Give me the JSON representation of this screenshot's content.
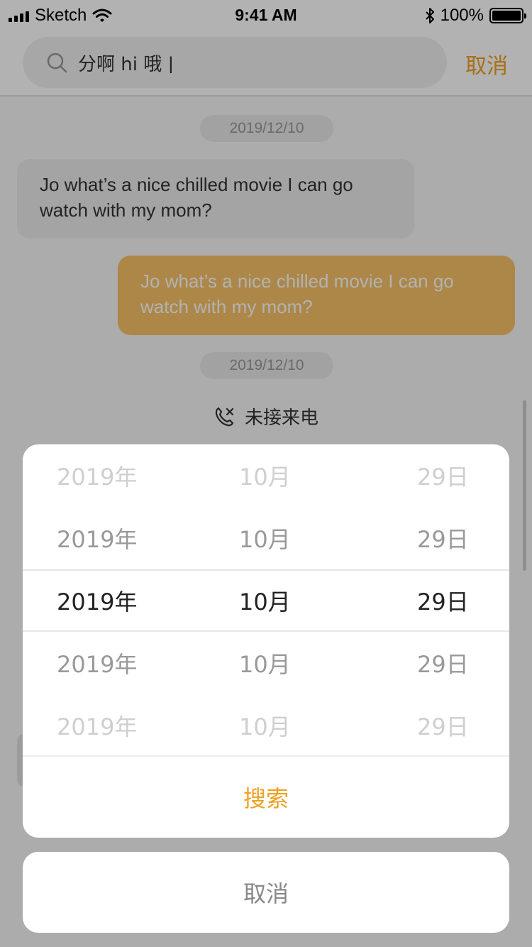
{
  "status_bar": {
    "carrier": "Sketch",
    "time": "9:41 AM",
    "battery": "100%",
    "icons": [
      "signal-icon",
      "wifi-icon",
      "bluetooth-icon",
      "battery-icon"
    ]
  },
  "search": {
    "value": "分啊 hi 哦 |",
    "cancel_label": "取消",
    "icon": "search-icon"
  },
  "chat": {
    "messages": [
      {
        "type": "date",
        "text": "2019/12/10"
      },
      {
        "type": "incoming",
        "text": "Jo what’s a nice chilled movie I can go watch with my mom?"
      },
      {
        "type": "outgoing",
        "text": "Jo what’s a nice chilled movie I can go watch with my mom?"
      },
      {
        "type": "date",
        "text": "2019/12/10"
      },
      {
        "type": "missed_call",
        "text": "未接来电",
        "icon": "missed-call-icon"
      }
    ]
  },
  "picker": {
    "rows": [
      {
        "year": "2019年",
        "month": "10月",
        "day": "29日"
      },
      {
        "year": "2019年",
        "month": "10月",
        "day": "29日"
      },
      {
        "year": "2019年",
        "month": "10月",
        "day": "29日"
      },
      {
        "year": "2019年",
        "month": "10月",
        "day": "29日"
      },
      {
        "year": "2019年",
        "month": "10月",
        "day": "29日"
      }
    ],
    "selected_index": 2,
    "confirm_label": "搜索",
    "cancel_label": "取消"
  },
  "colors": {
    "accent": "#f0a020",
    "outgoing_bubble": "#f7c266",
    "incoming_bubble": "#ebebeb",
    "overlay": "rgba(0,0,0,0.30)"
  }
}
